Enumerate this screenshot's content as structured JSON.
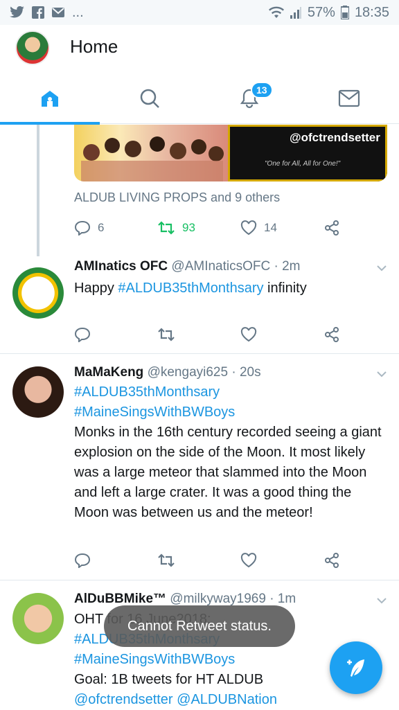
{
  "status_bar": {
    "notification_icons": [
      "twitter-icon",
      "facebook-icon",
      "mail-icon"
    ],
    "more": "...",
    "battery": "57%",
    "time": "18:35"
  },
  "header": {
    "title": "Home"
  },
  "tabs": [
    {
      "name": "home",
      "icon": "home-icon",
      "active": true
    },
    {
      "name": "search",
      "icon": "search-icon"
    },
    {
      "name": "notifications",
      "icon": "bell-icon",
      "badge": "13"
    },
    {
      "name": "messages",
      "icon": "mail-icon"
    }
  ],
  "first_tweet": {
    "media_text": "@ofctrendsetter",
    "media_tagline": "\"One for All, All for One!\"",
    "retweeters": "ALDUB LIVING PROPS and 9 others",
    "replies": "6",
    "retweets": "93",
    "likes": "14"
  },
  "tweets": [
    {
      "name": "AMInatics OFC",
      "handle": "@AMInaticsOFC",
      "time": "· 2m",
      "body_link": "#ALDUB35thMonthsary",
      "body_prefix": "Happy ",
      "body_suffix": " infinity"
    },
    {
      "name": "MaMaKeng",
      "handle": "@kengayi625",
      "time": "· 20s",
      "hashtag1": "#ALDUB35thMonthsary",
      "hashtag2": "#MaineSingsWithBWBoys",
      "body": "Monks in the 16th century recorded seeing a giant explosion on the side of the Moon. It most likely was a large meteor that slammed into the Moon and left a large crater. It was a good thing the Moon was between us and the meteor!"
    },
    {
      "name": "AlDuBBMike™",
      "handle": "@milkyway1969",
      "time": "· 1m",
      "line1": "OHT for 16 June2018:",
      "hashtag1": "#ALDUB35thMonthsary",
      "hashtag2": "#MaineSingsWithBWBoys",
      "line4": "Goal: 1B tweets for HT ALDUB",
      "mentions": "@ofctrendsetter @ALDUBNation"
    }
  ],
  "toast": "Cannot Retweet status.",
  "colors": {
    "accent": "#1da1f2",
    "retweet_green": "#17bf63",
    "muted": "#657786"
  }
}
